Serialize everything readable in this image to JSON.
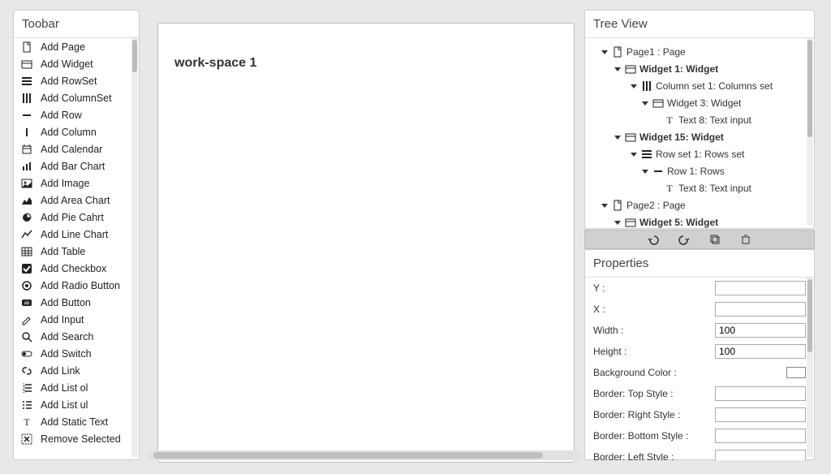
{
  "toolbar": {
    "header": "Toobar",
    "items": [
      {
        "icon": "page",
        "label": "Add Page"
      },
      {
        "icon": "widget",
        "label": "Add Widget"
      },
      {
        "icon": "rows",
        "label": "Add RowSet"
      },
      {
        "icon": "cols",
        "label": "Add ColumnSet"
      },
      {
        "icon": "minus",
        "label": "Add Row"
      },
      {
        "icon": "pipe",
        "label": "Add Column"
      },
      {
        "icon": "calendar",
        "label": "Add Calendar"
      },
      {
        "icon": "bar",
        "label": "Add Bar Chart"
      },
      {
        "icon": "image",
        "label": "Add Image"
      },
      {
        "icon": "area",
        "label": "Add Area Chart"
      },
      {
        "icon": "pie",
        "label": "Add Pie Cahrt"
      },
      {
        "icon": "line",
        "label": "Add Line Chart"
      },
      {
        "icon": "table",
        "label": "Add Table"
      },
      {
        "icon": "checkbox",
        "label": "Add Checkbox"
      },
      {
        "icon": "radio",
        "label": "Add Radio Button"
      },
      {
        "icon": "button",
        "label": "Add Button"
      },
      {
        "icon": "input",
        "label": "Add Input"
      },
      {
        "icon": "search",
        "label": "Add Search"
      },
      {
        "icon": "switch",
        "label": "Add Switch"
      },
      {
        "icon": "link",
        "label": "Add Link"
      },
      {
        "icon": "listol",
        "label": "Add List ol"
      },
      {
        "icon": "listul",
        "label": "Add List ul"
      },
      {
        "icon": "text",
        "label": "Add Static Text"
      },
      {
        "icon": "remove",
        "label": "Remove Selected"
      }
    ]
  },
  "canvas": {
    "title": "work-space 1"
  },
  "tree": {
    "header": "Tree View",
    "nodes": [
      {
        "ind": 1,
        "open": true,
        "icon": "page",
        "label": "Page1 : Page",
        "bold": false
      },
      {
        "ind": 2,
        "open": true,
        "icon": "widget",
        "label": "Widget 1: Widget",
        "bold": true
      },
      {
        "ind": 3,
        "open": true,
        "icon": "cols",
        "label": "Column set 1: Columns set",
        "bold": false
      },
      {
        "ind": 4,
        "open": true,
        "icon": "widget",
        "label": "Widget 3: Widget",
        "bold": false
      },
      {
        "ind": 5,
        "open": false,
        "icon": "text",
        "label": "Text 8: Text input",
        "bold": false
      },
      {
        "ind": 2,
        "open": true,
        "icon": "widget",
        "label": "Widget 15: Widget",
        "bold": true
      },
      {
        "ind": 3,
        "open": true,
        "icon": "rows",
        "label": "Row set 1: Rows set",
        "bold": false
      },
      {
        "ind": 4,
        "open": true,
        "icon": "minus",
        "label": "Row 1: Rows",
        "bold": false
      },
      {
        "ind": 5,
        "open": false,
        "icon": "text",
        "label": "Text 8: Text input",
        "bold": false
      },
      {
        "ind": 1,
        "open": true,
        "icon": "page",
        "label": "Page2 : Page",
        "bold": false
      },
      {
        "ind": 2,
        "open": true,
        "icon": "widget",
        "label": "Widget 5: Widget",
        "bold": true
      }
    ]
  },
  "actions": {
    "undo": "undo",
    "redo": "redo",
    "copy": "copy",
    "trash": "trash"
  },
  "properties": {
    "header": "Properties",
    "rows": [
      {
        "label": "Y :",
        "value": ""
      },
      {
        "label": "X :",
        "value": ""
      },
      {
        "label": "Width :",
        "value": "100"
      },
      {
        "label": "Height :",
        "value": "100"
      },
      {
        "label": "Background Color :",
        "type": "color",
        "value": "#ffffff"
      },
      {
        "label": "Border: Top Style :",
        "value": ""
      },
      {
        "label": "Border: Right Style :",
        "value": ""
      },
      {
        "label": "Border: Bottom Style :",
        "value": ""
      },
      {
        "label": "Border: Left Style :",
        "value": ""
      }
    ]
  }
}
